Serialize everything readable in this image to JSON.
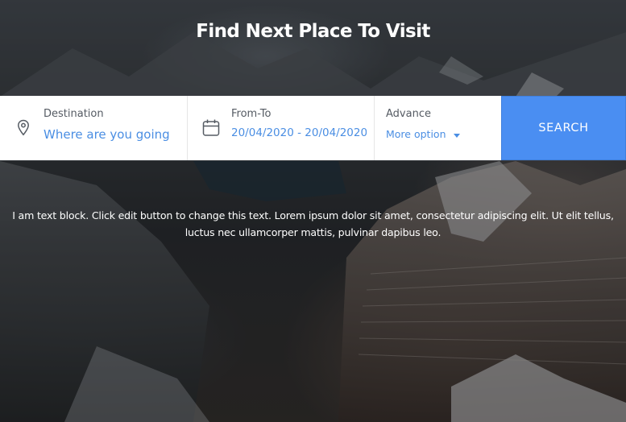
{
  "hero": {
    "title": "Find Next Place To Visit",
    "text_block": "I am text block. Click edit button to change this text. Lorem ipsum dolor sit amet, consectetur adipiscing elit. Ut elit tellus, luctus nec ullamcorper mattis, pulvinar dapibus leo."
  },
  "search": {
    "destination": {
      "label": "Destination",
      "placeholder": "Where are you going",
      "icon": "map-pin-icon"
    },
    "date": {
      "label": "From-To",
      "value": "20/04/2020 - 20/04/2020",
      "icon": "calendar-icon"
    },
    "advance": {
      "label": "Advance",
      "more_option": "More option",
      "icon": "chevron-down-icon"
    },
    "button_label": "SEARCH"
  },
  "colors": {
    "accent": "#4a8ef2",
    "link": "#4a8ee3",
    "label": "#555b63"
  }
}
